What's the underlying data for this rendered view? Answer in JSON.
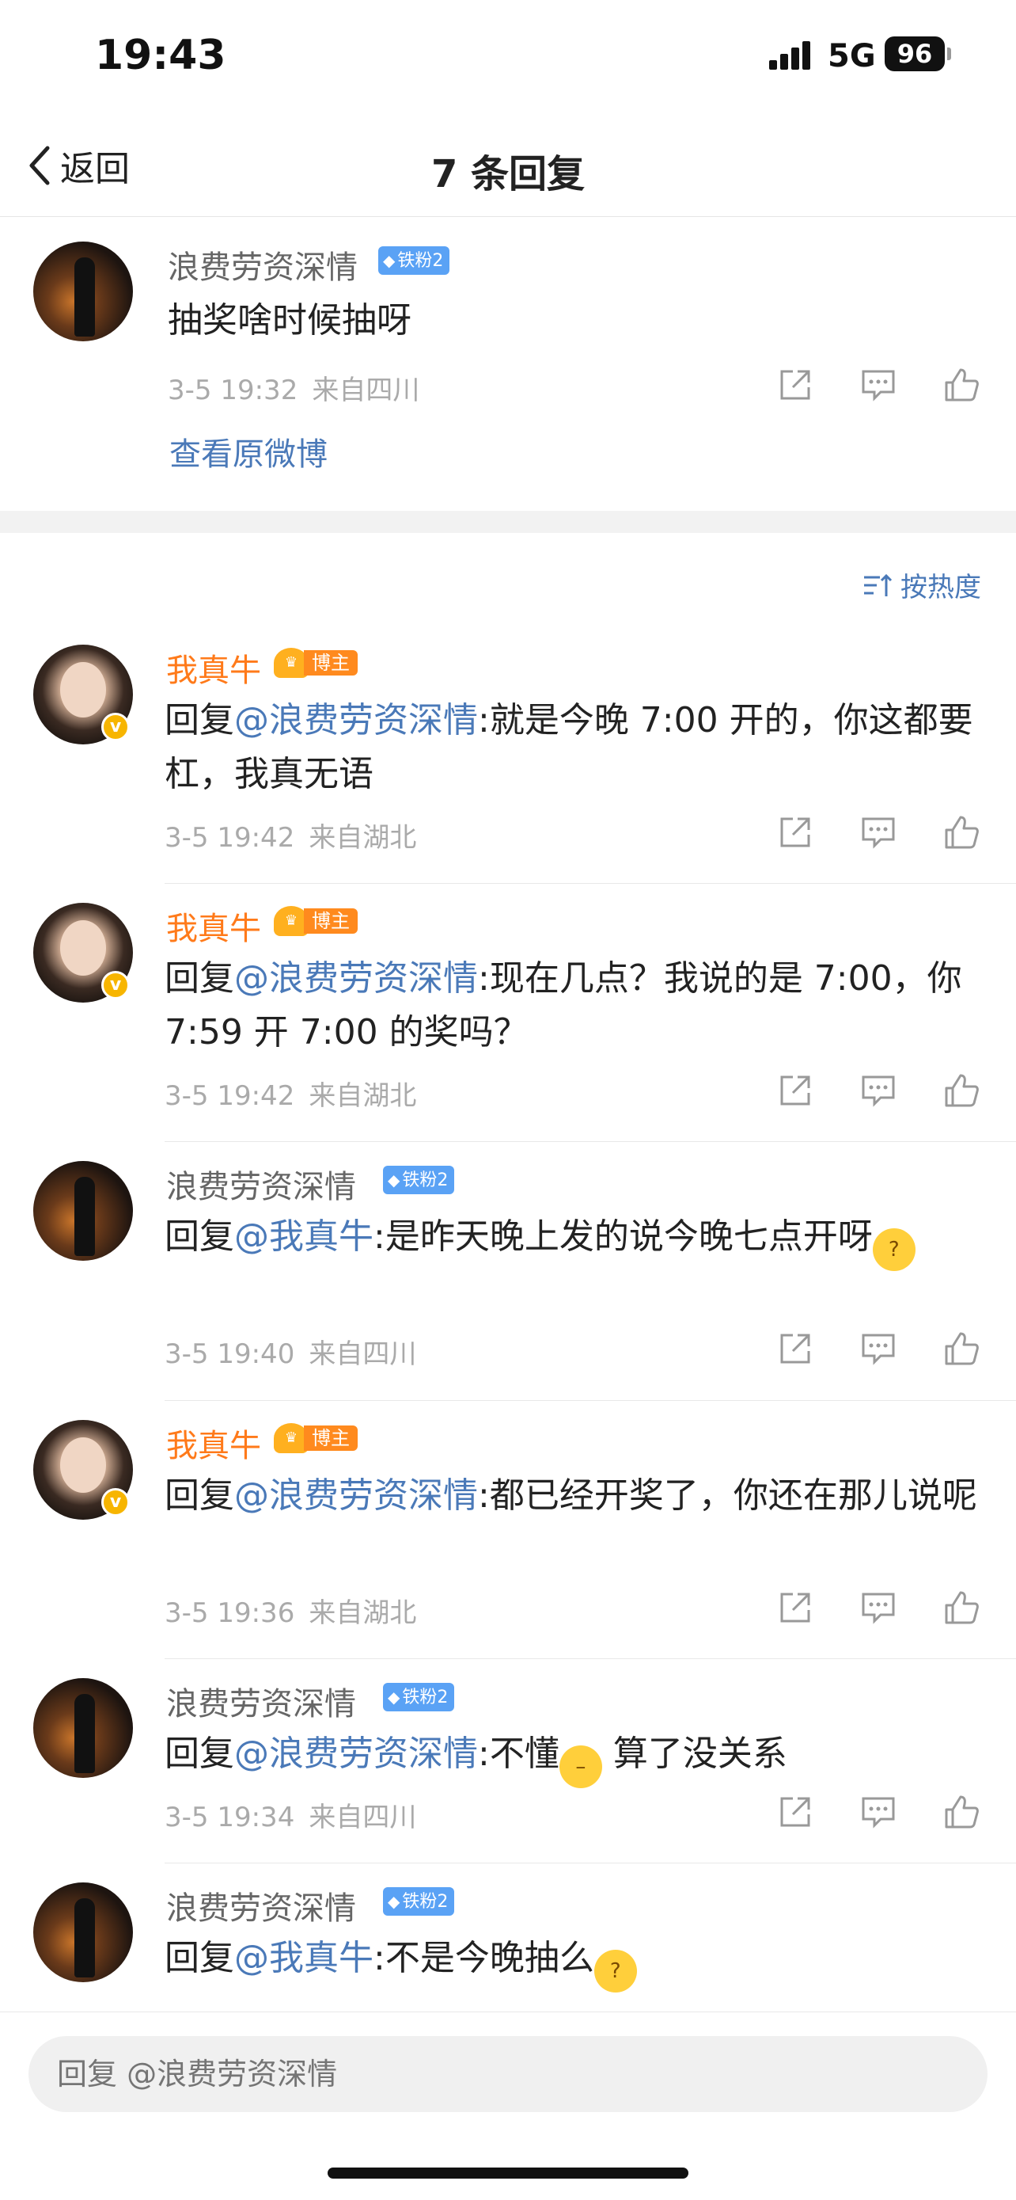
{
  "status_bar": {
    "time": "19:43",
    "network": "5G",
    "battery": "96"
  },
  "nav": {
    "back_label": "返回",
    "title": "7 条回复"
  },
  "original": {
    "name": "浪费劳资深情",
    "badge": "铁粉2",
    "text": "抽奖啥时候抽呀",
    "time": "3-5 19:32",
    "source": "来自四川",
    "view_original": "查看原微博"
  },
  "sort_label": "按热度",
  "replies": [
    {
      "name": "我真牛",
      "badge": "博主",
      "author": true,
      "prefix": "回复",
      "mention": "@浪费劳资深情",
      "text": ":就是今晚 7:00 开的，你这都要杠，我真无语",
      "time": "3-5 19:42",
      "source": "来自湖北"
    },
    {
      "name": "我真牛",
      "badge": "博主",
      "author": true,
      "prefix": "回复",
      "mention": "@浪费劳资深情",
      "text": ":现在几点？我说的是 7:00，你 7:59 开 7:00 的奖吗？",
      "time": "3-5 19:42",
      "source": "来自湖北"
    },
    {
      "name": "浪费劳资深情",
      "badge": "铁粉2",
      "author": false,
      "prefix": "回复",
      "mention": "@我真牛",
      "text": ":是昨天晚上发的说今晚七点开呀",
      "emoji": "thinking-face",
      "time": "3-5 19:40",
      "source": "来自四川"
    },
    {
      "name": "我真牛",
      "badge": "博主",
      "author": true,
      "prefix": "回复",
      "mention": "@浪费劳资深情",
      "text": ":都已经开奖了，你还在那儿说呢",
      "time": "3-5 19:36",
      "source": "来自湖北"
    },
    {
      "name": "浪费劳资深情",
      "badge": "铁粉2",
      "author": false,
      "prefix": "回复",
      "mention": "@浪费劳资深情",
      "text": ":不懂",
      "emoji": "unamused-face",
      "text_after": " 算了没关系",
      "time": "3-5 19:34",
      "source": "来自四川"
    },
    {
      "name": "浪费劳资深情",
      "badge": "铁粉2",
      "author": false,
      "prefix": "回复",
      "mention": "@我真牛",
      "text": ":不是今晚抽么",
      "emoji": "thinking-face",
      "time": "",
      "source": ""
    }
  ],
  "input": {
    "placeholder": "回复 @浪费劳资深情"
  },
  "colors": {
    "author_name": "#ff7a1a",
    "mention": "#4a79b8",
    "fan_badge": "#5aa2f5",
    "meta": "#aaaaaa"
  }
}
